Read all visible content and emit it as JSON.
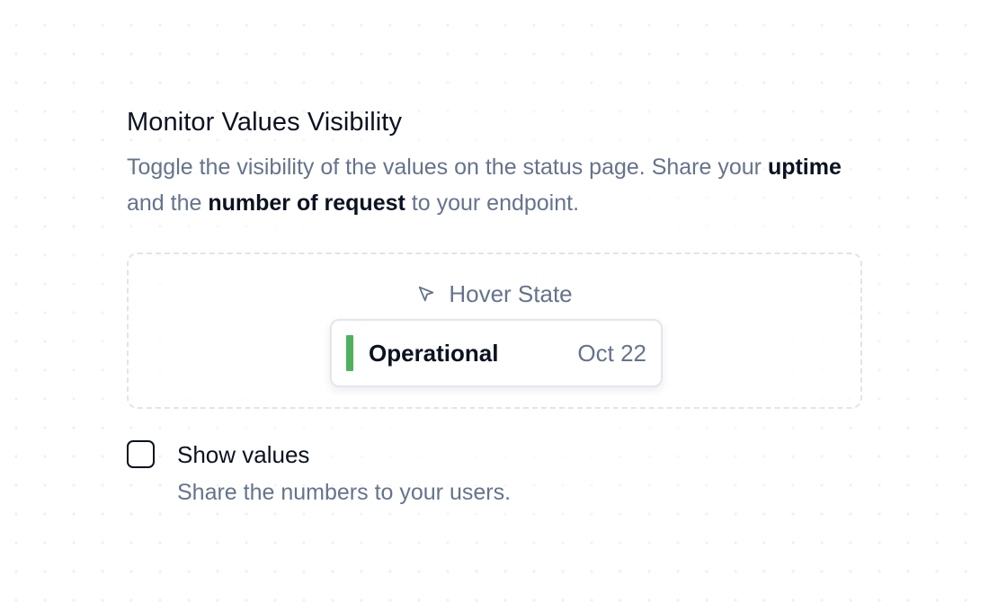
{
  "section": {
    "title": "Monitor Values Visibility",
    "description": {
      "part1": "Toggle the visibility of the values on the status page. Share your ",
      "bold1": "uptime",
      "part2": " and the ",
      "bold2": "number of request",
      "part3": " to your endpoint."
    }
  },
  "preview": {
    "hover_label": "Hover State",
    "hover_icon": "cursor-pointer-icon",
    "tooltip": {
      "status": "Operational",
      "date": "Oct 22",
      "status_color": "#4fb15f"
    }
  },
  "option": {
    "checked": false,
    "label": "Show values",
    "help": "Share the numbers to your users."
  }
}
